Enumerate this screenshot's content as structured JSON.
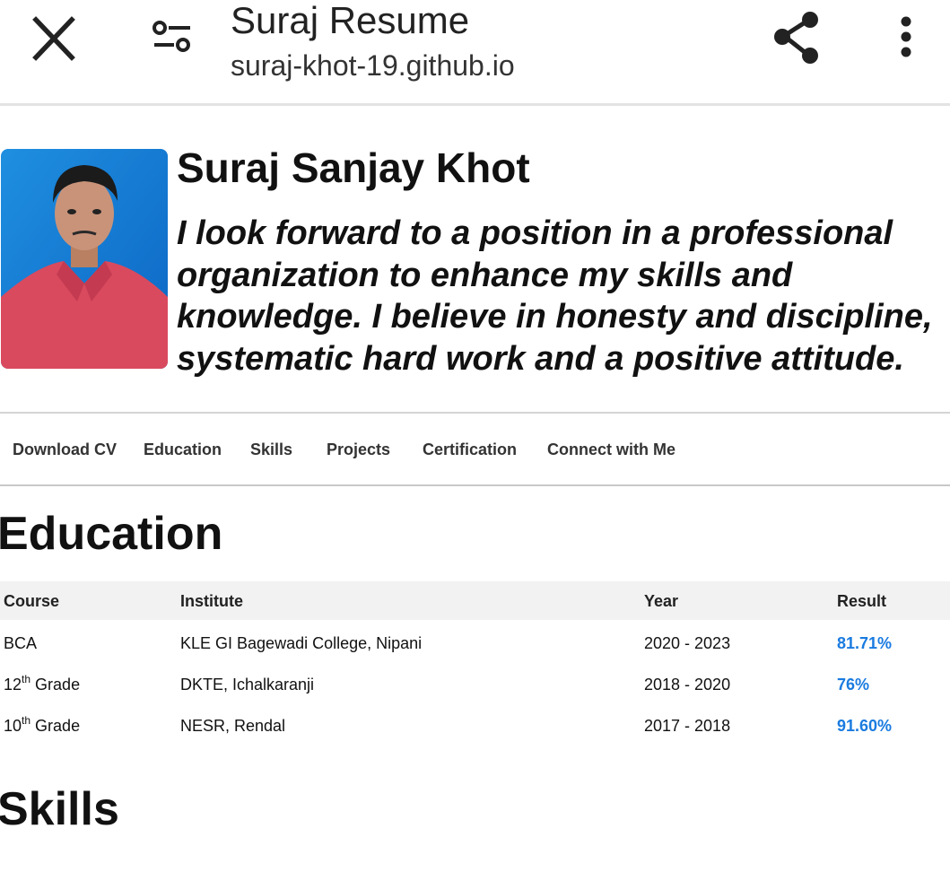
{
  "browser": {
    "title": "Suraj Resume",
    "url": "suraj-khot-19.github.io",
    "icons": {
      "close": "close-icon",
      "settings": "tune-icon",
      "share": "share-icon",
      "more": "more-vert-icon"
    }
  },
  "profile": {
    "name": "Suraj Sanjay Khot",
    "tagline": "I look forward to a position in a professional organization to enhance my skills and knowledge. I believe in honesty and discipline, systematic hard work and a positive attitude."
  },
  "nav": {
    "items": [
      "Download CV",
      "Education",
      "Skills",
      "Projects",
      "Certification",
      "Connect with Me"
    ]
  },
  "education": {
    "title": "Education",
    "headers": [
      "Course",
      "Institute",
      "Year",
      "Result"
    ],
    "rows": [
      {
        "course": "BCA",
        "sup": "",
        "suffix": "",
        "institute": "KLE GI Bagewadi College, Nipani",
        "year": "2020 - 2023",
        "result": "81.71%"
      },
      {
        "course": "12",
        "sup": "th",
        "suffix": " Grade",
        "institute": "DKTE, Ichalkaranji",
        "year": "2018 - 2020",
        "result": "76%"
      },
      {
        "course": "10",
        "sup": "th",
        "suffix": " Grade",
        "institute": "NESR, Rendal",
        "year": "2017 - 2018",
        "result": "91.60%"
      }
    ]
  },
  "skills": {
    "title": "Skills"
  },
  "colors": {
    "accent": "#1a7be0",
    "header_bg": "#f2f2f2",
    "divider": "#d4d4d4"
  }
}
